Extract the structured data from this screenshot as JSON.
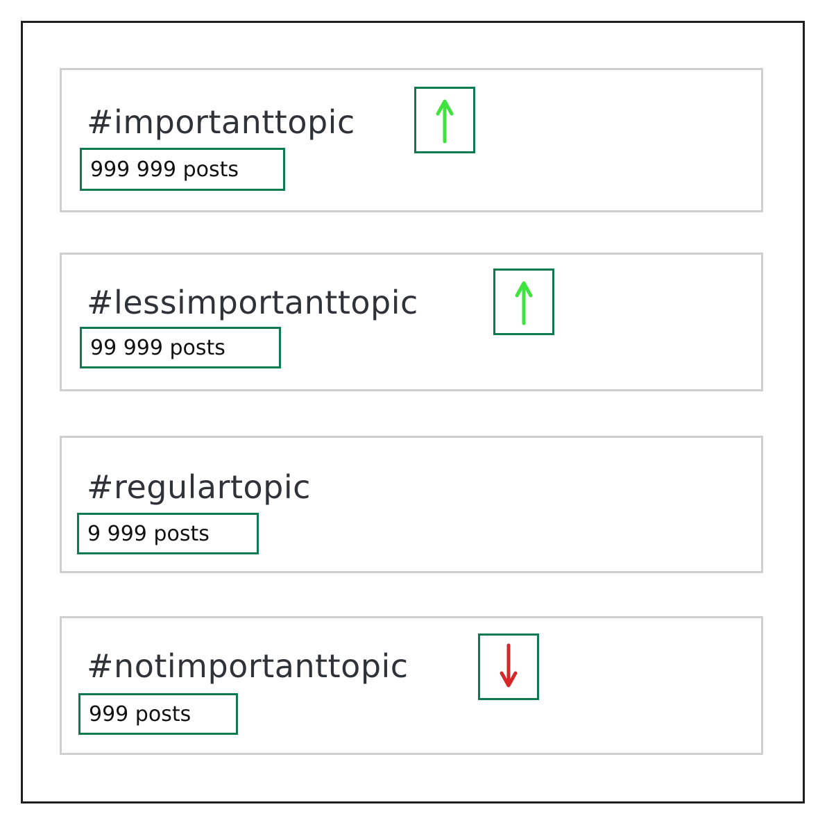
{
  "topics": [
    {
      "tag": "#importanttopic",
      "count": "999 999 posts",
      "trend": "up",
      "trend_icon": "arrow-up-icon",
      "trend_color": "#3ee33e"
    },
    {
      "tag": "#lessimportanttopic",
      "count": "99 999 posts",
      "trend": "up",
      "trend_icon": "arrow-up-icon",
      "trend_color": "#3ee33e"
    },
    {
      "tag": "#regulartopic",
      "count": "9 999 posts",
      "trend": "none"
    },
    {
      "tag": "#notimportanttopic",
      "count": "999 posts",
      "trend": "down",
      "trend_icon": "arrow-down-icon",
      "trend_color": "#d62828"
    }
  ],
  "colors": {
    "badge_border": "#0c7a4e",
    "card_border": "#cfcfcf",
    "frame_border": "#1e1e1e",
    "title_text": "#2f3338"
  }
}
